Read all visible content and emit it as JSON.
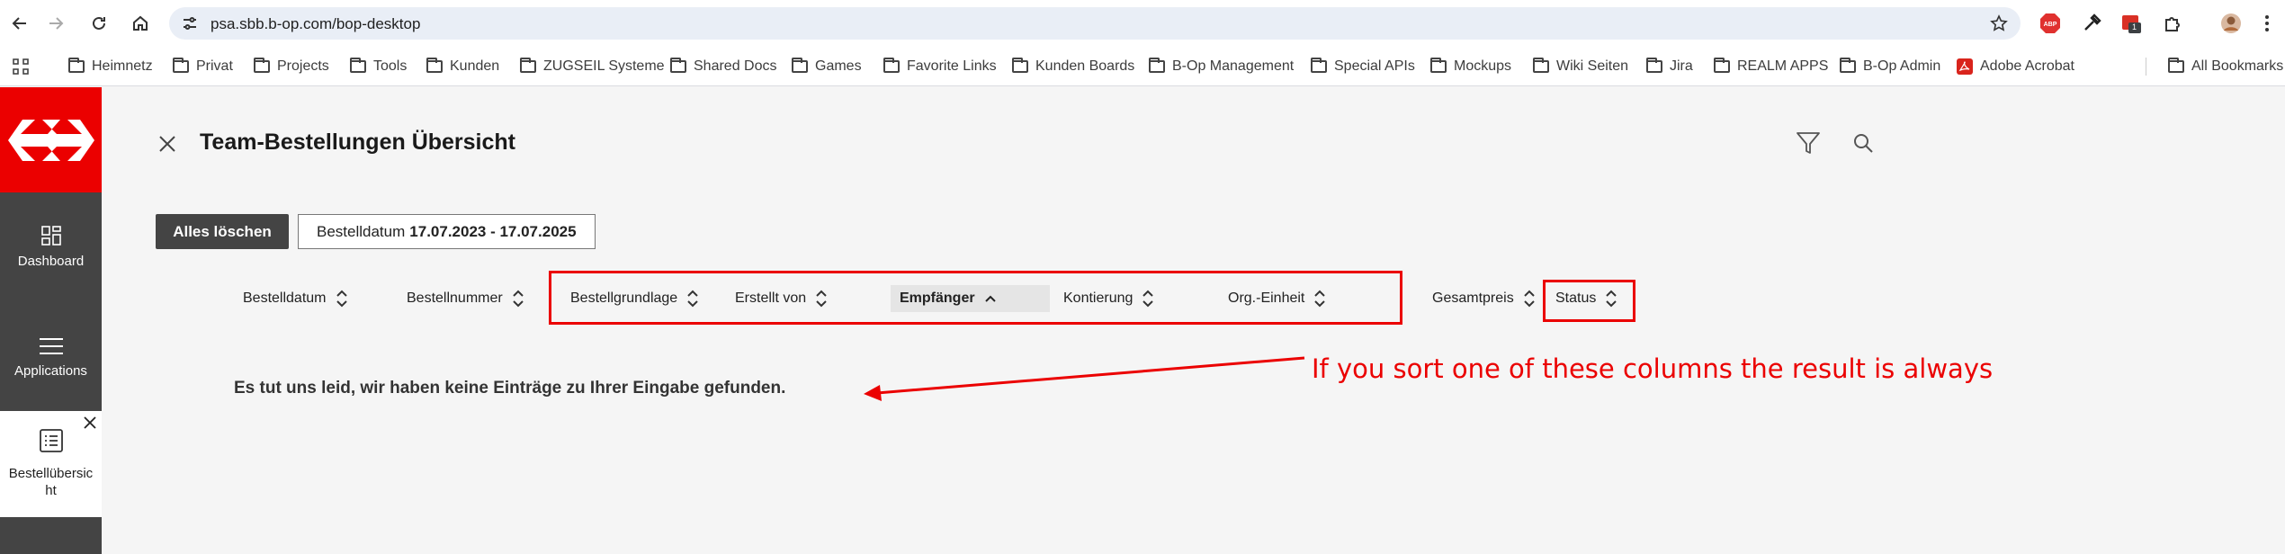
{
  "browser": {
    "url": "psa.sbb.b-op.com/bop-desktop",
    "extension_badge": "1",
    "bookmarks": [
      "Heimnetz",
      "Privat",
      "Projects",
      "Tools",
      "Kunden",
      "ZUGSEIL Systeme",
      "Shared Docs",
      "Games",
      "Favorite Links",
      "Kunden Boards",
      "B-Op Management",
      "Special APIs",
      "Mockups",
      "Wiki Seiten",
      "Jira",
      "REALM APPS",
      "B-Op Admin",
      "Adobe Acrobat"
    ],
    "all_bookmarks": "All Bookmarks"
  },
  "sidebar": {
    "items": [
      {
        "label": "Dashboard",
        "icon": "dashboard-icon"
      },
      {
        "label": "Applications",
        "icon": "menu-icon"
      },
      {
        "label": "Bestellübersic\nht",
        "icon": "list-icon"
      }
    ]
  },
  "main": {
    "title": "Team-Bestellungen Übersicht",
    "clear_all": "Alles löschen",
    "date_filter": {
      "label": "Bestelldatum",
      "value": "17.07.2023 - 17.07.2025"
    },
    "columns": [
      "Bestelldatum",
      "Bestellnummer",
      "Bestellgrundlage",
      "Erstellt von",
      "Empfänger",
      "Kontierung",
      "Org.-Einheit",
      "Gesamtpreis",
      "Status"
    ],
    "active_sort_column": "Empfänger",
    "empty_message": "Es tut uns leid, wir haben keine Einträge zu Ihrer Eingabe gefunden."
  },
  "annotation": {
    "text": "If you sort one of these columns the result is always",
    "color": "#eb0000"
  },
  "colors": {
    "brand_red": "#eb0000",
    "sidebar": "#444444"
  }
}
